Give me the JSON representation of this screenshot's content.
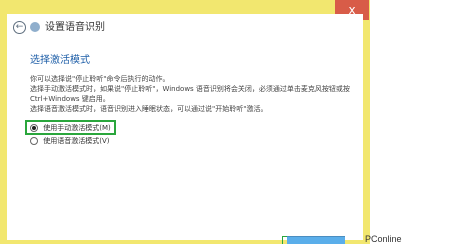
{
  "window": {
    "title": "设置语音识别",
    "close_glyph": "x"
  },
  "page": {
    "section_title": "选择激活模式",
    "description_lines": [
      "你可以选择说\"停止聆听\"命令后执行的动作。",
      "选择手动激活模式时，如果说\"停止聆听\"，Windows 语音识别将会关闭，必须通过单击麦克风按钮或按",
      "Ctrl+Windows 键启用。",
      "选择语音激活模式时，语音识别进入睡眠状态，可以通过说\"开始聆听\"激活。"
    ],
    "options": [
      {
        "label": "使用手动激活模式(M)",
        "checked": true
      },
      {
        "label": "使用语音激活模式(V)",
        "checked": false
      }
    ]
  },
  "watermark": {
    "text": "PConline"
  },
  "colors": {
    "frame": "#f2e76f",
    "close_button": "#d85c48",
    "section_title": "#1f5fa8",
    "highlight_box": "#2aa63c"
  }
}
